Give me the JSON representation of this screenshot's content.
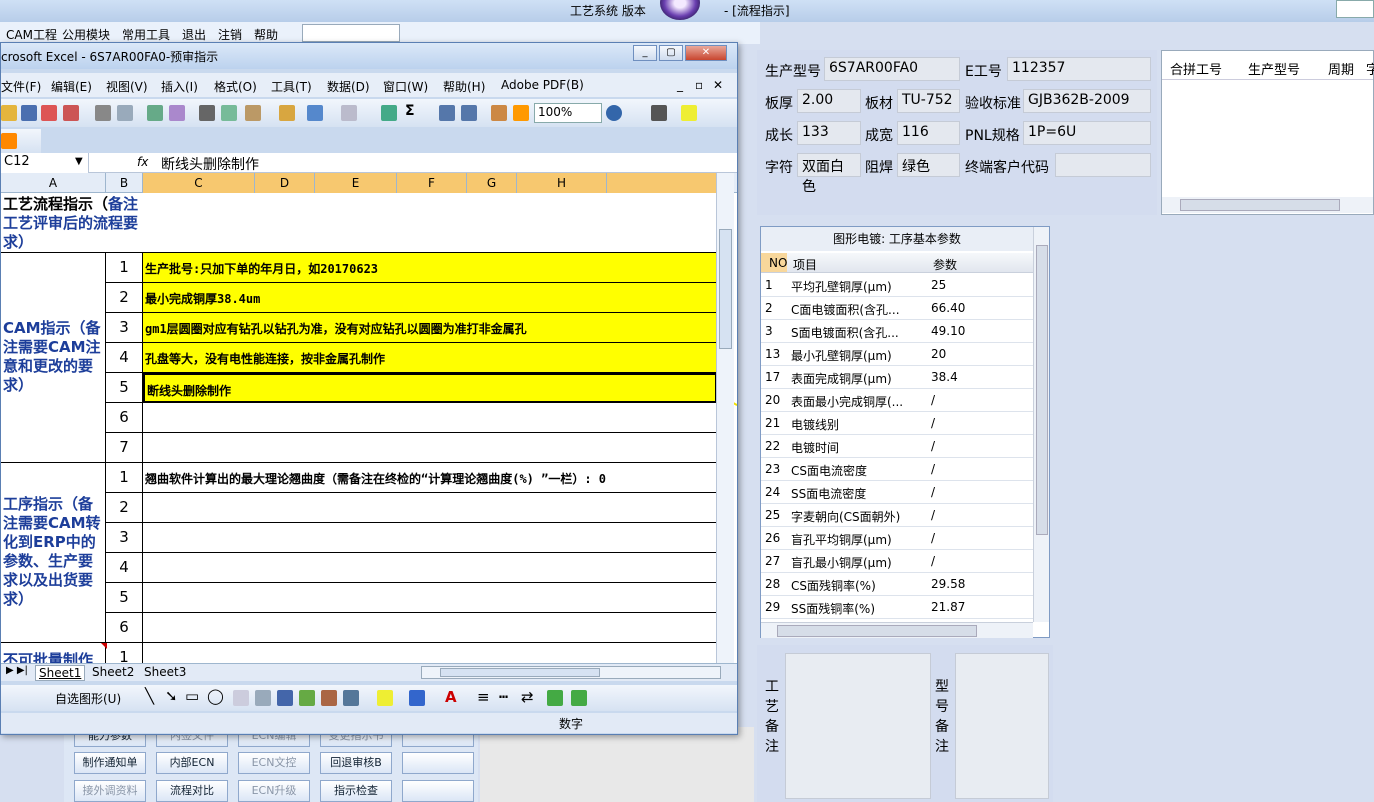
{
  "app": {
    "title": "工艺系统 版本",
    "title_suffix": "- [流程指示]",
    "menu": [
      "CAM工程",
      "公用模块",
      "常用工具",
      "退出",
      "注销",
      "帮助"
    ],
    "bottom_buttons": [
      {
        "label": "能力参数",
        "disabled": false
      },
      {
        "label": "内签文件",
        "disabled": true
      },
      {
        "label": "ECN编辑",
        "disabled": true
      },
      {
        "label": "变更指示书",
        "disabled": true
      },
      {
        "label": "制作通知单",
        "disabled": false
      },
      {
        "label": "内部ECN",
        "disabled": false
      },
      {
        "label": "ECN文控",
        "disabled": true
      },
      {
        "label": "回退审核B",
        "disabled": false
      },
      {
        "label": "接外调资料",
        "disabled": true
      },
      {
        "label": "流程对比",
        "disabled": false
      },
      {
        "label": "ECN升级",
        "disabled": true
      },
      {
        "label": "指示检查",
        "disabled": false
      }
    ]
  },
  "info": {
    "production_model_label": "生产型号",
    "production_model": "6S7AR00FA0",
    "e_no_label": "E工号",
    "e_no": "112357",
    "thickness_label": "板厚",
    "thickness": "2.00",
    "material_label": "板材",
    "material": "TU-752",
    "acceptance_label": "验收标准",
    "acceptance": "GJB362B-2009",
    "length_label": "成长",
    "length": "133",
    "width_label": "成宽",
    "width": "116",
    "pnl_label": "PNL规格",
    "pnl": "1P=6U",
    "char_label": "字符",
    "char": "双面白色",
    "mask_label": "阻焊",
    "mask": "绿色",
    "customer_label": "终端客户代码",
    "customer": ""
  },
  "merge_table": {
    "headers": [
      "合拼工号",
      "生产型号",
      "周期",
      "字"
    ]
  },
  "plating": {
    "title": "图形电镀: 工序基本参数",
    "headers": [
      "NO",
      "项目",
      "参数"
    ],
    "rows": [
      {
        "no": "1",
        "item": "平均孔壁铜厚(μm)",
        "val": "25"
      },
      {
        "no": "2",
        "item": "C面电镀面积(含孔...",
        "val": "66.40"
      },
      {
        "no": "3",
        "item": "S面电镀面积(含孔...",
        "val": "49.10"
      },
      {
        "no": "13",
        "item": "最小孔壁铜厚(μm)",
        "val": "20"
      },
      {
        "no": "17",
        "item": "表面完成铜厚(μm)",
        "val": "38.4"
      },
      {
        "no": "20",
        "item": "表面最小完成铜厚(...",
        "val": "/"
      },
      {
        "no": "21",
        "item": "电镀线别",
        "val": "/"
      },
      {
        "no": "22",
        "item": "电镀时间",
        "val": "/"
      },
      {
        "no": "23",
        "item": "CS面电流密度",
        "val": "/"
      },
      {
        "no": "24",
        "item": "SS面电流密度",
        "val": "/"
      },
      {
        "no": "25",
        "item": "字麦朝向(CS面朝外)",
        "val": "/"
      },
      {
        "no": "26",
        "item": "盲孔平均铜厚(μm)",
        "val": "/"
      },
      {
        "no": "27",
        "item": "盲孔最小铜厚(μm)",
        "val": "/"
      },
      {
        "no": "28",
        "item": "CS面残铜率(%)",
        "val": "29.58"
      },
      {
        "no": "29",
        "item": "SS面残铜率(%)",
        "val": "21.87"
      }
    ]
  },
  "remarks": {
    "process_label": "工艺备注",
    "model_label": "型号备注"
  },
  "excel": {
    "title": "crosoft Excel - 6S7AR00FA0-预审指示",
    "menu": [
      "文件(F)",
      "编辑(E)",
      "视图(V)",
      "插入(I)",
      "格式(O)",
      "工具(T)",
      "数据(D)",
      "窗口(W)",
      "帮助(H)",
      "Adobe PDF(B)"
    ],
    "zoom": "100%",
    "name_box": "C12",
    "fx": "fx",
    "formula": "断线头删除制作",
    "columns": [
      "A",
      "B",
      "C",
      "D",
      "E",
      "F",
      "G",
      "H"
    ],
    "section1": {
      "text": "工艺流程指示（",
      "tail": "备注工艺评审后的流程要求）"
    },
    "section2": {
      "text": "CAM指示（备注需要CAM注意和更改的要求）"
    },
    "section3": {
      "text": "工序指示（备注需要CAM转化到ERP中的参数、生产要求以及出货要求）"
    },
    "section4": {
      "text": "不可批量制作"
    },
    "cam_rows": [
      {
        "n": "1",
        "text": "生产批号:只加下单的年月日，如20170623"
      },
      {
        "n": "2",
        "text": "最小完成铜厚38.4um"
      },
      {
        "n": "3",
        "text": "gm1层圆圈对应有钻孔以钻孔为准，没有对应钻孔以圆圈为准打非金属孔"
      },
      {
        "n": "4",
        "text": "孔盘等大，没有电性能连接，按非金属孔制作"
      },
      {
        "n": "5",
        "text": "断线头删除制作"
      },
      {
        "n": "6",
        "text": ""
      },
      {
        "n": "7",
        "text": ""
      }
    ],
    "proc_rows": [
      {
        "n": "1",
        "text": "翘曲软件计算出的最大理论翘曲度（需备注在终检的“计算理论翘曲度(%) ”一栏）: 0"
      },
      {
        "n": "2",
        "text": ""
      },
      {
        "n": "3",
        "text": ""
      },
      {
        "n": "4",
        "text": ""
      },
      {
        "n": "5",
        "text": ""
      },
      {
        "n": "6",
        "text": ""
      }
    ],
    "last_row_num": "1",
    "sheets": [
      "Sheet1",
      "Sheet2",
      "Sheet3"
    ],
    "draw_label": "自选图形(U)",
    "status": "数字"
  }
}
